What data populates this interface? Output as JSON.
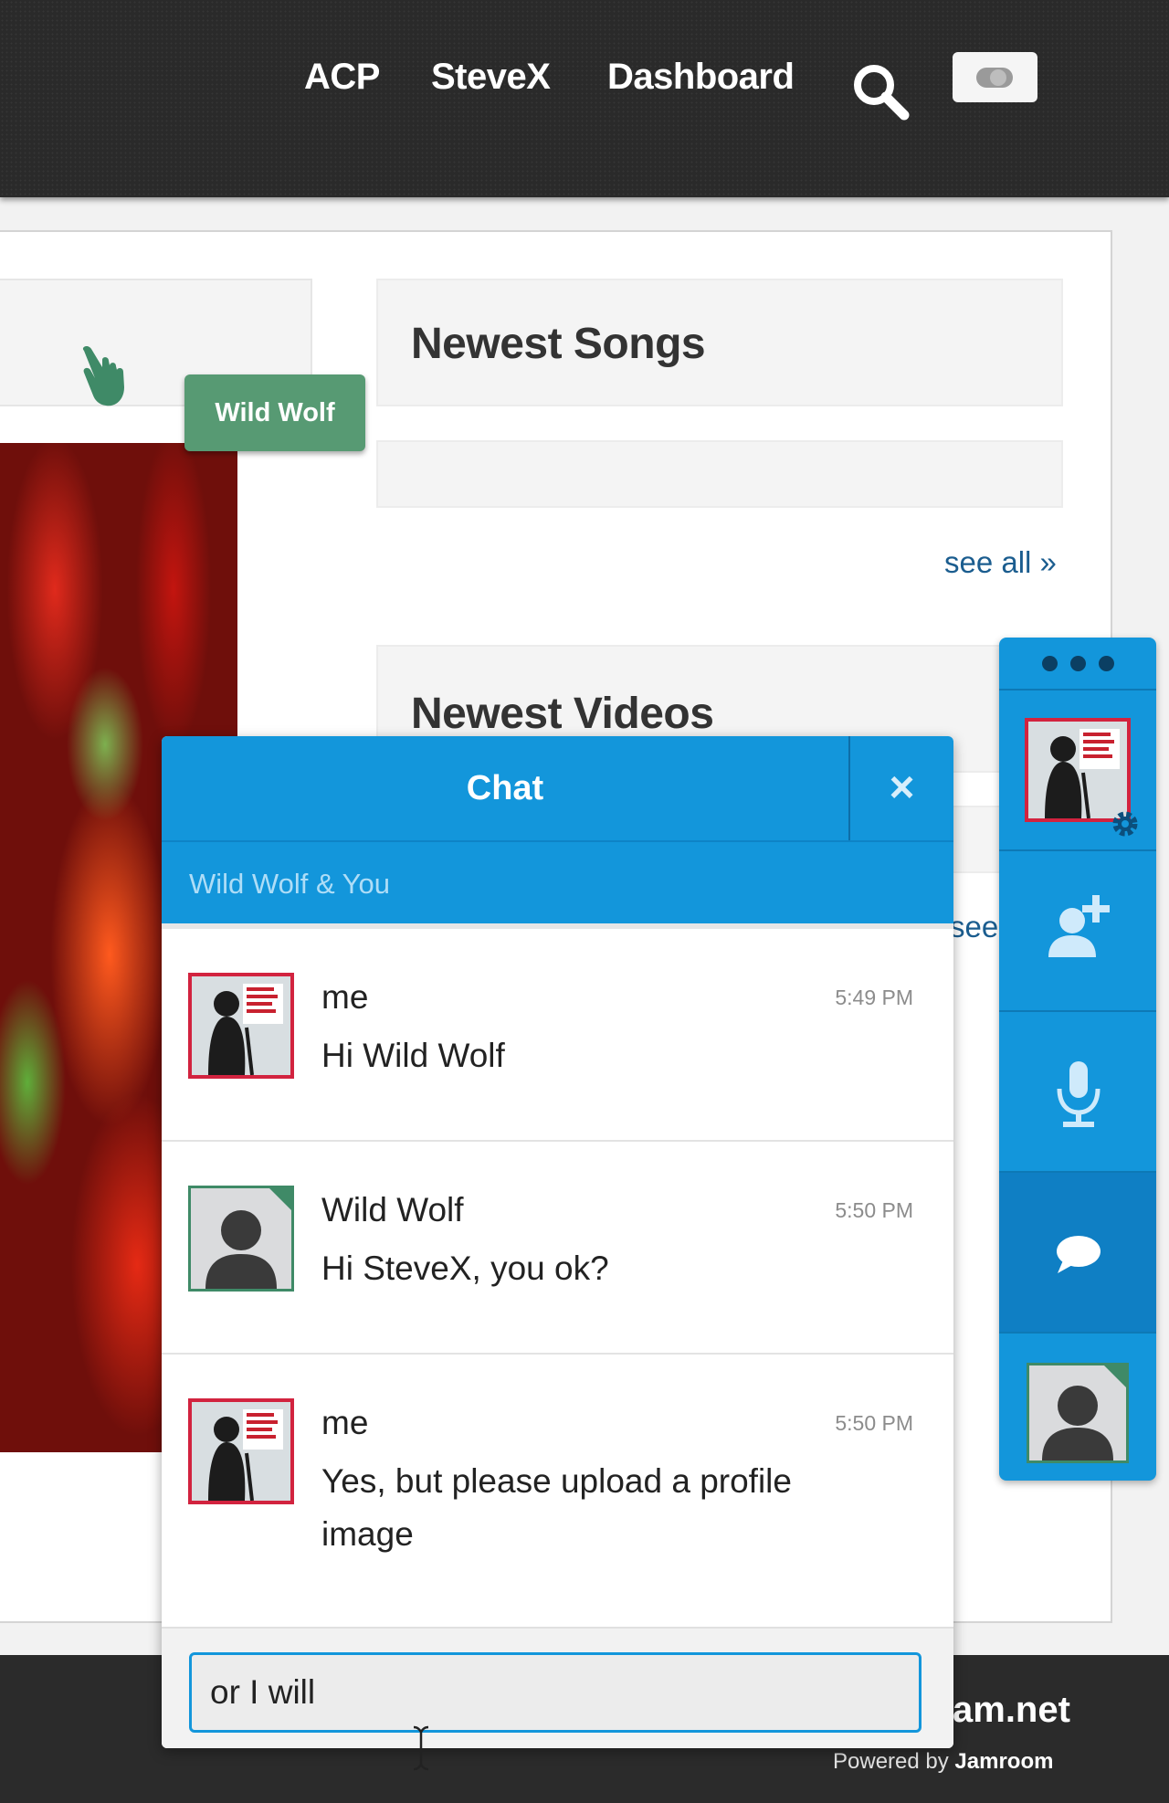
{
  "header": {
    "nav": [
      {
        "label": "ACP"
      },
      {
        "label": "SteveX"
      },
      {
        "label": "Dashboard"
      }
    ],
    "icons": {
      "search": "search-icon",
      "toggle": "toggle-icon"
    }
  },
  "content": {
    "tooltip": "Wild Wolf",
    "newest_songs": {
      "title": "Newest Songs",
      "see_all": "see all »"
    },
    "newest_videos": {
      "title": "Newest Videos",
      "see_partial": "see"
    }
  },
  "footer": {
    "site": "am.net",
    "powered_prefix": "Powered by ",
    "powered_brand": "Jamroom"
  },
  "chat": {
    "title": "Chat",
    "close": "×",
    "subtitle": "Wild Wolf & You",
    "messages": [
      {
        "name": "me",
        "time": "5:49 PM",
        "text": "Hi Wild Wolf"
      },
      {
        "name": "Wild Wolf",
        "time": "5:50 PM",
        "text": "Hi SteveX, you ok?"
      },
      {
        "name": "me",
        "time": "5:50 PM",
        "text": "Yes, but please upload a profile image"
      }
    ],
    "input_value": "or I will "
  },
  "sidebar": {
    "icons": [
      "more-icon",
      "gear-icon",
      "add-user-icon",
      "microphone-icon",
      "chat-bubble-icon"
    ]
  },
  "colors": {
    "accent": "#1396db",
    "accent_dark": "#0f7fc4",
    "tooltip": "#579a73",
    "avatar_border_me": "#d2233f",
    "avatar_border_other": "#3f8a67",
    "link": "#1b5d8f"
  }
}
